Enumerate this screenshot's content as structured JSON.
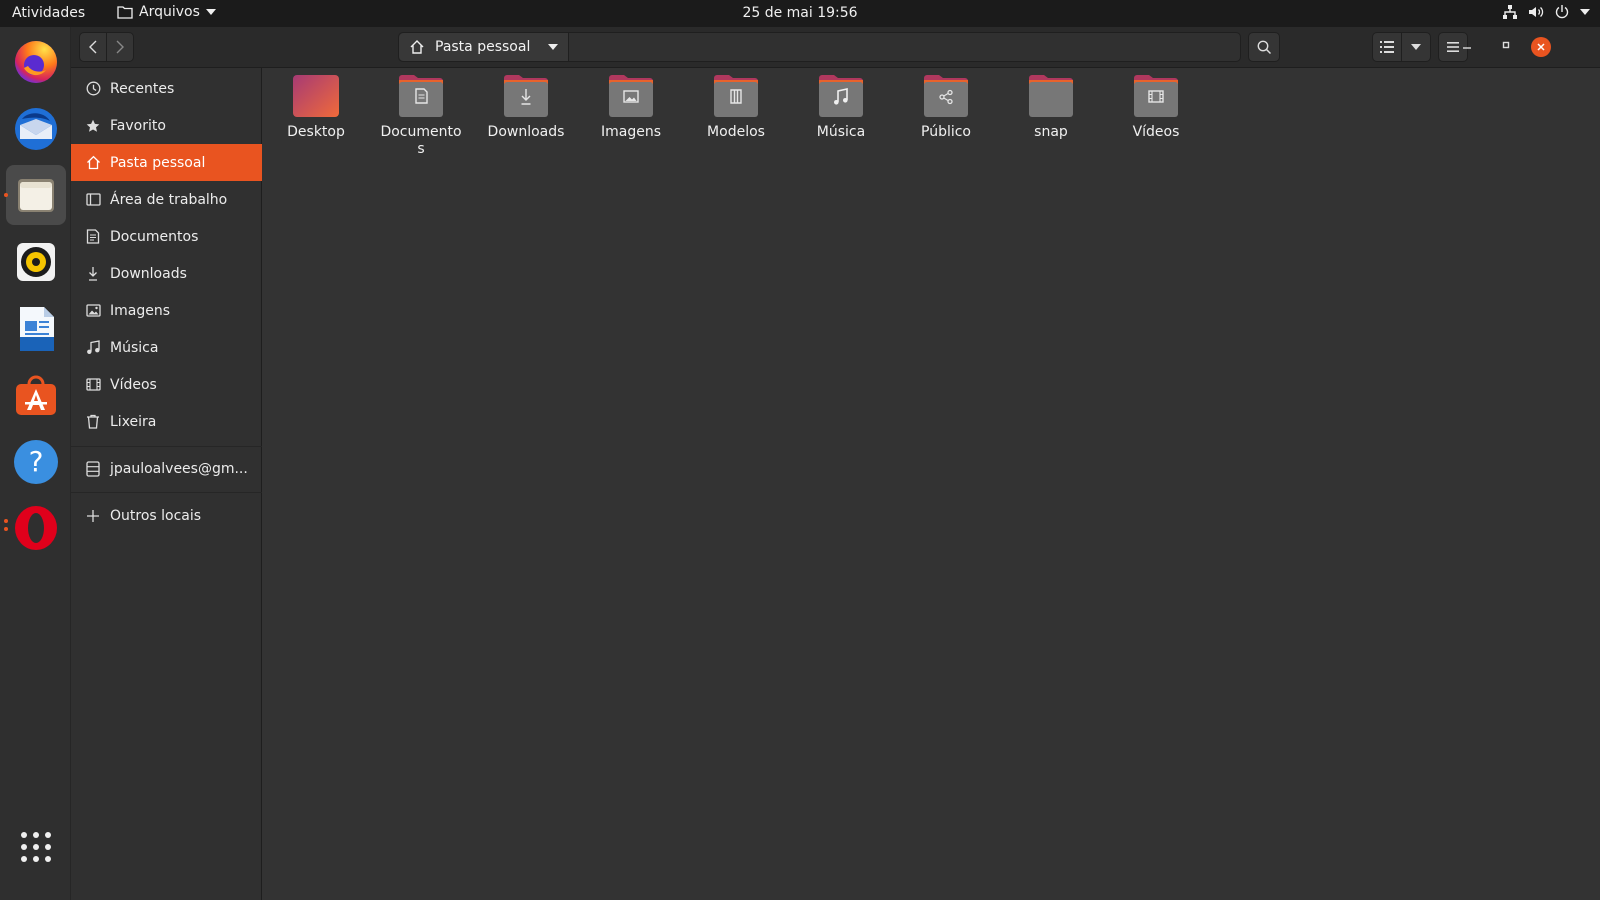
{
  "topbar": {
    "activities": "Atividades",
    "app_name": "Arquivos",
    "clock": "25 de mai  19:56",
    "tray": [
      "network-icon",
      "volume-icon",
      "power-icon",
      "chevron-down-icon"
    ]
  },
  "dock": {
    "apps": [
      {
        "name": "Firefox",
        "icon": "firefox-icon"
      },
      {
        "name": "Thunderbird",
        "icon": "thunderbird-icon"
      },
      {
        "name": "Arquivos",
        "icon": "files-icon",
        "active": true
      },
      {
        "name": "Rhythmbox",
        "icon": "rhythmbox-icon"
      },
      {
        "name": "LibreOffice Writer",
        "icon": "writer-icon"
      },
      {
        "name": "Ubuntu Software",
        "icon": "software-icon"
      },
      {
        "name": "Ajuda",
        "icon": "help-icon"
      },
      {
        "name": "Opera",
        "icon": "opera-icon"
      }
    ],
    "show_apps": "app-grid-icon"
  },
  "headerbar": {
    "location": "Pasta pessoal"
  },
  "sidebar": {
    "items": [
      {
        "label": "Recentes",
        "icon": "clock-icon"
      },
      {
        "label": "Favorito",
        "icon": "star-icon"
      },
      {
        "label": "Pasta pessoal",
        "icon": "home-icon",
        "selected": true
      },
      {
        "label": "Área de trabalho",
        "icon": "desktop-icon"
      },
      {
        "label": "Documentos",
        "icon": "document-icon"
      },
      {
        "label": "Downloads",
        "icon": "download-icon"
      },
      {
        "label": "Imagens",
        "icon": "image-icon"
      },
      {
        "label": "Música",
        "icon": "music-icon"
      },
      {
        "label": "Vídeos",
        "icon": "video-icon"
      },
      {
        "label": "Lixeira",
        "icon": "trash-icon"
      }
    ],
    "account": {
      "label": "jpauloalvees@gm...",
      "icon": "network-drive-icon"
    },
    "other": {
      "label": "Outros locais",
      "icon": "plus-icon"
    }
  },
  "folders": [
    {
      "label": "Desktop",
      "icon": "desktop-folder-icon"
    },
    {
      "label": "Documentos",
      "icon": "documents-folder-icon"
    },
    {
      "label": "Downloads",
      "icon": "downloads-folder-icon"
    },
    {
      "label": "Imagens",
      "icon": "images-folder-icon"
    },
    {
      "label": "Modelos",
      "icon": "templates-folder-icon"
    },
    {
      "label": "Música",
      "icon": "music-folder-icon"
    },
    {
      "label": "Público",
      "icon": "public-folder-icon"
    },
    {
      "label": "snap",
      "icon": "folder-icon"
    },
    {
      "label": "Vídeos",
      "icon": "videos-folder-icon"
    }
  ],
  "colors": {
    "accent": "#e95420",
    "topbar": "#1b1b1b",
    "sidebar": "#303030",
    "content": "#333333"
  }
}
